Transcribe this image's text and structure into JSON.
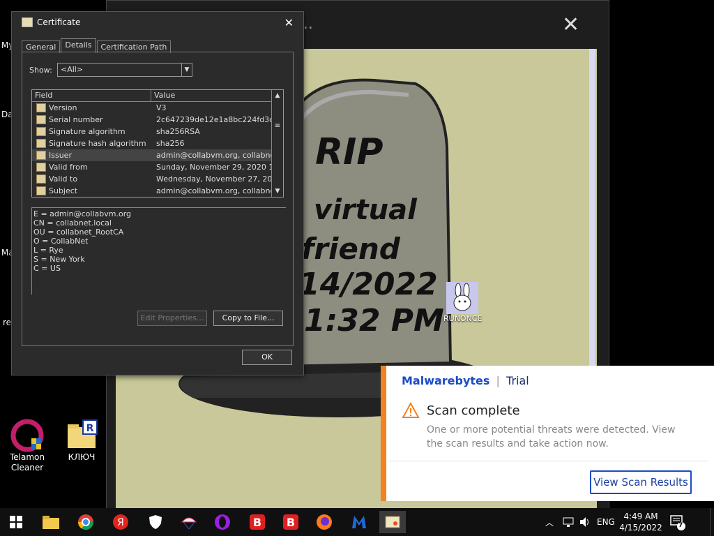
{
  "desktop": {
    "partial_labels": [
      "My",
      "Da",
      "Ma",
      "re"
    ],
    "icons": [
      {
        "label_line1": "Telamon",
        "label_line2": "Cleaner"
      },
      {
        "label_line1": "КЛЮЧ",
        "label_line2": ""
      }
    ],
    "runonce_label": "RUNONCE"
  },
  "background_window": {
    "title_fragment": "y...",
    "close_glyph": "✕",
    "tomb": {
      "line1": "RIP",
      "line2": "virtual",
      "line3": "friend",
      "line4": "14/2022",
      "line5": "1:32 PM"
    }
  },
  "certificate": {
    "title": "Certificate",
    "close_glyph": "✕",
    "tabs": [
      "General",
      "Details",
      "Certification Path"
    ],
    "active_tab": "Details",
    "show_label": "Show:",
    "show_value": "<All>",
    "columns": [
      "Field",
      "Value"
    ],
    "rows": [
      {
        "field": "Version",
        "value": "V3"
      },
      {
        "field": "Serial number",
        "value": "2c647239de12e1a8bc224fd3d..."
      },
      {
        "field": "Signature algorithm",
        "value": "sha256RSA"
      },
      {
        "field": "Signature hash algorithm",
        "value": "sha256"
      },
      {
        "field": "Issuer",
        "value": "admin@collabvm.org, collabne..."
      },
      {
        "field": "Valid from",
        "value": "Sunday, November 29, 2020 1..."
      },
      {
        "field": "Valid to",
        "value": "Wednesday, November 27, 20..."
      },
      {
        "field": "Subject",
        "value": "admin@collabvm.org, collabne..."
      }
    ],
    "selected_row": "Issuer",
    "detail_lines": [
      "E = admin@collabvm.org",
      "CN = collabnet.local",
      "OU = collabnet_RootCA",
      "O = CollabNet",
      "L = Rye",
      "S = New York",
      "C = US"
    ],
    "edit_properties": "Edit Properties...",
    "copy_to_file": "Copy to File...",
    "ok": "OK"
  },
  "notification": {
    "brand": "Malwarebytes",
    "edition": "Trial",
    "title": "Scan complete",
    "body": "One or more potential threats were detected. View the scan results and take action now.",
    "button": "View Scan Results",
    "accent": "#f58220"
  },
  "taskbar": {
    "language": "ENG",
    "time": "4:49 AM",
    "date": "4/15/2022",
    "notification_count": "7"
  }
}
